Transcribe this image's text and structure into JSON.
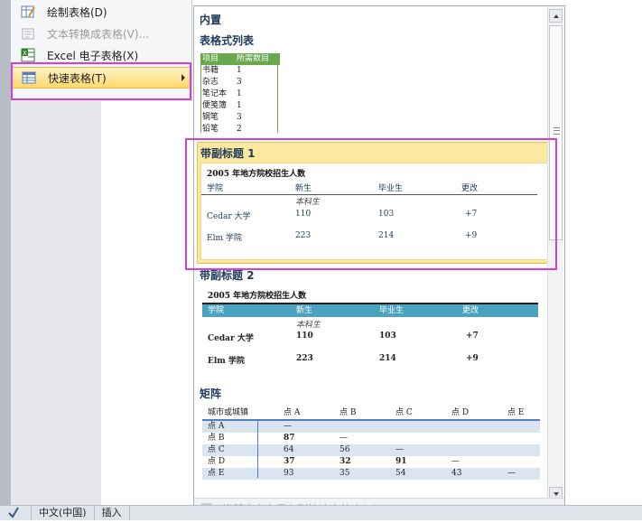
{
  "menu": {
    "items": [
      {
        "label": "绘制表格(D)",
        "icon": "draw-table-icon",
        "state": "normal"
      },
      {
        "label": "文本转换成表格(V)...",
        "icon": "text-to-table-icon",
        "state": "disabled"
      },
      {
        "label": "Excel 电子表格(X)",
        "icon": "excel-icon",
        "state": "normal"
      },
      {
        "label": "快速表格(T)",
        "icon": "quick-table-icon",
        "state": "active"
      }
    ]
  },
  "gallery": {
    "header": "内置",
    "sections": {
      "tabular_list": {
        "title": "表格式列表",
        "header": [
          "项目",
          "所需数目"
        ],
        "rows": [
          [
            "书籍",
            "1"
          ],
          [
            "杂志",
            "3"
          ],
          [
            "笔记本",
            "1"
          ],
          [
            "便笺簿",
            "1"
          ],
          [
            "钢笔",
            "3"
          ],
          [
            "铅笔",
            "2"
          ]
        ]
      },
      "subheading1": {
        "title": "带副标题 1",
        "caption": "2005 年地方院校招生人数",
        "columns": [
          "学院",
          "新生",
          "毕业生",
          "更改"
        ],
        "subheader": "本科生",
        "rows": [
          [
            "Cedar 大学",
            "110",
            "103",
            "+7"
          ],
          [
            "Elm 学院",
            "223",
            "214",
            "+9"
          ]
        ]
      },
      "subheading2": {
        "title": "带副标题 2",
        "caption": "2005 年地方院校招生人数",
        "columns": [
          "学院",
          "新生",
          "毕业生",
          "更改"
        ],
        "subheader": "本科生",
        "rows": [
          [
            "Cedar 大学",
            "110",
            "103",
            "+7"
          ],
          [
            "Elm 学院",
            "223",
            "214",
            "+9"
          ]
        ]
      },
      "matrix": {
        "title": "矩阵",
        "columns": [
          "城市或城镇",
          "点 A",
          "点 B",
          "点 C",
          "点 D",
          "点 E"
        ],
        "rows": [
          [
            "点 A",
            "—",
            "",
            "",
            "",
            ""
          ],
          [
            "点 B",
            "87",
            "—",
            "",
            "",
            ""
          ],
          [
            "点 C",
            "64",
            "56",
            "—",
            "",
            ""
          ],
          [
            "点 D",
            "37",
            "32",
            "91",
            "—",
            ""
          ],
          [
            "点 E",
            "93",
            "35",
            "54",
            "43",
            "—"
          ]
        ]
      }
    },
    "footer": "将所选内容保存到快速表格库(S)..."
  },
  "statusbar": {
    "language": "中文(中国)",
    "mode": "插入"
  },
  "colors": {
    "accent_header": "#1e395b",
    "highlight": "#d63fd6",
    "table_teal": "#4aa3c0",
    "list_green": "#6aa84f"
  }
}
